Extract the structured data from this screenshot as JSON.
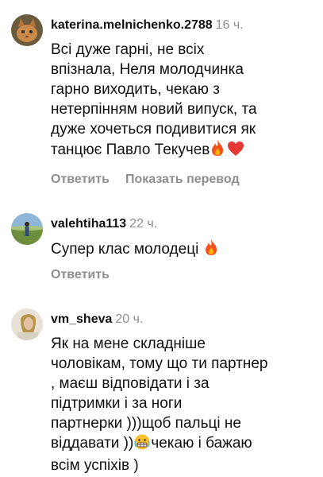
{
  "comments": [
    {
      "username": "katerina.melnichenko.2788",
      "time": "16 ч.",
      "lines": [
        "Всі дуже гарні, не всіх",
        "впізнала, Неля молодчинка",
        "гарно виходить, чекаю з",
        "нетерпінням новий випуск, та",
        "дуже хочеться подивитися як",
        "танцює Павло Текучев"
      ],
      "emojis": [
        "fire-emoji",
        "red-heart-emoji"
      ],
      "reply_label": "Ответить",
      "translate_label": "Показать перевод"
    },
    {
      "username": "valehtiha113",
      "time": "22 ч.",
      "lines": [
        "Супер клас молодеці "
      ],
      "emojis": [
        "fire-emoji"
      ],
      "reply_label": "Ответить"
    },
    {
      "username": "vm_sheva",
      "time": "20 ч.",
      "lines": [
        "Як на мене складніше",
        "чоловікам, тому що ти партнер",
        ", маєш відповідати і за",
        "підтримки і за ноги",
        "партнерки )))щоб пальці не",
        "віддавати ))",
        "чекаю і бажаю",
        "всім успіхів )"
      ],
      "emojis": [
        "grimacing-face-emoji"
      ]
    }
  ]
}
